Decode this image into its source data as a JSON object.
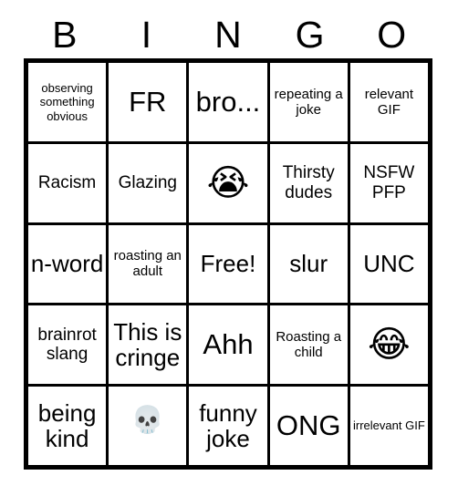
{
  "card": {
    "title_letters": [
      "B",
      "I",
      "N",
      "G",
      "O"
    ],
    "grid_size": "5x5",
    "colors": {
      "border": "#000000",
      "cell_background": "#ffffff",
      "text": "#000000",
      "page_background": "#ffffff"
    },
    "rows": [
      [
        {
          "text": "observing something obvious",
          "size": "xs",
          "kind": "text"
        },
        {
          "text": "FR",
          "size": "xl",
          "kind": "text"
        },
        {
          "text": "bro...",
          "size": "xl",
          "kind": "text"
        },
        {
          "text": "repeating a joke",
          "size": "sm",
          "kind": "text"
        },
        {
          "text": "relevant GIF",
          "size": "sm",
          "kind": "text"
        }
      ],
      [
        {
          "text": "Racism",
          "size": "md",
          "kind": "text"
        },
        {
          "text": "Glazing",
          "size": "md",
          "kind": "text"
        },
        {
          "text": "😭",
          "size": "emoji-lg",
          "kind": "emoji",
          "emoji_name": "loudly-crying-face"
        },
        {
          "text": "Thirsty dudes",
          "size": "md",
          "kind": "text"
        },
        {
          "text": "NSFW PFP",
          "size": "md",
          "kind": "text"
        }
      ],
      [
        {
          "text": "n-word",
          "size": "lg",
          "kind": "text"
        },
        {
          "text": "roasting an adult",
          "size": "sm",
          "kind": "text"
        },
        {
          "text": "Free!",
          "size": "lg",
          "kind": "text"
        },
        {
          "text": "slur",
          "size": "lg",
          "kind": "text"
        },
        {
          "text": "UNC",
          "size": "lg",
          "kind": "text"
        }
      ],
      [
        {
          "text": "brainrot slang",
          "size": "md",
          "kind": "text"
        },
        {
          "text": "This is cringe",
          "size": "lg",
          "kind": "text"
        },
        {
          "text": "Ahh",
          "size": "xl",
          "kind": "text"
        },
        {
          "text": "Roasting a child",
          "size": "sm",
          "kind": "text"
        },
        {
          "text": "😂",
          "size": "emoji-lg",
          "kind": "emoji",
          "emoji_name": "face-with-tears-of-joy"
        }
      ],
      [
        {
          "text": "being kind",
          "size": "lg",
          "kind": "text"
        },
        {
          "text": "💀",
          "size": "emoji-sm",
          "kind": "emoji",
          "emoji_name": "skull"
        },
        {
          "text": "funny joke",
          "size": "lg",
          "kind": "text"
        },
        {
          "text": "ONG",
          "size": "xl",
          "kind": "text"
        },
        {
          "text": "irrelevant GIF",
          "size": "xs",
          "kind": "text"
        }
      ]
    ]
  }
}
